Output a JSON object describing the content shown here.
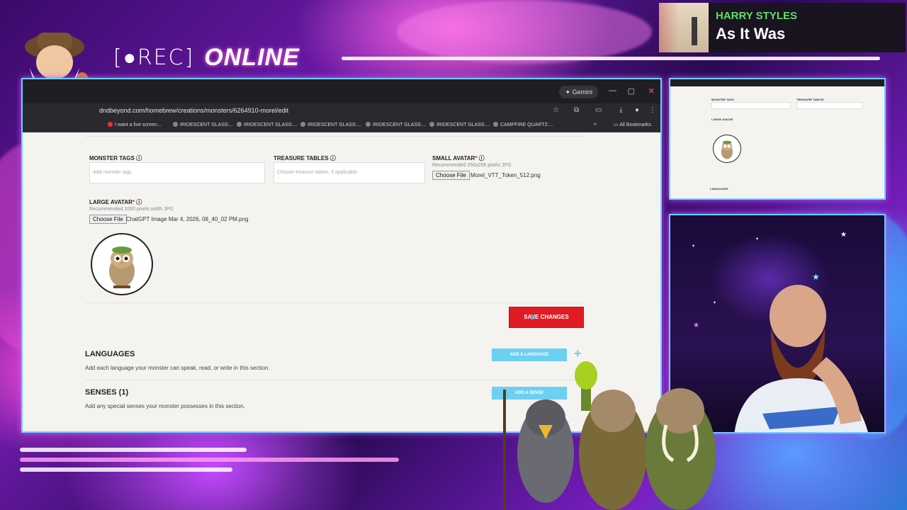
{
  "overlay": {
    "rec_label": "REC",
    "online_label": "ONLINE",
    "now_playing": {
      "artist": "HARRY STYLES",
      "song": "As It Was"
    }
  },
  "browser": {
    "gemini_label": "Gemini",
    "url": "dndbeyond.com/homebrew/creations/monsters/6264910-morel/edit",
    "bookmarks": [
      "I want a live screen...",
      "IRIDESCENT GLASS:...",
      "IRIDESCENT GLASS:...",
      "IRIDESCENT GLASS:...",
      "IRIDESCENT GLASS:...",
      "IRIDESCENT GLASS:...",
      "CAMPFIRE QUARTZ:..."
    ],
    "all_bookmarks": "All Bookmarks"
  },
  "form": {
    "monster_tags": {
      "label": "MONSTER TAGS",
      "placeholder": "Add monster tags"
    },
    "treasure_tables": {
      "label": "TREASURE TABLES",
      "placeholder": "Choose treasure tables, if applicable"
    },
    "small_avatar": {
      "label": "SMALL AVATAR",
      "required": "*",
      "hint": "Recommended 256x256 pixels JPG",
      "button": "Choose File",
      "filename": "Morel_VTT_Token_512.png"
    },
    "large_avatar": {
      "label": "LARGE AVATAR",
      "required": "*",
      "hint": "Recommended 1000 pixels width JPG",
      "button": "Choose File",
      "filename": "ChatGPT Image Mar 4, 2026, 08_40_02 PM.png"
    },
    "save_button": "SAVE CHANGES",
    "languages": {
      "title": "LANGUAGES",
      "desc": "Add each language your monster can speak, read, or write in this section.",
      "button": "ADD A LANGUAGE"
    },
    "senses": {
      "title": "SENSES (1)",
      "desc": "Add any special senses your monster possesses in this section.",
      "button": "ADD A SENSE"
    }
  },
  "preview": {
    "monster_tags": "MONSTER TAGS",
    "treasure_tables": "TREASURE TABLES",
    "large_avatar": "LARGE AVATAR",
    "languages": "LANGUAGES"
  },
  "colors": {
    "accent_red": "#e01b24",
    "accent_cyan": "#6cd0f2",
    "spotify_green": "#5ee06a"
  }
}
